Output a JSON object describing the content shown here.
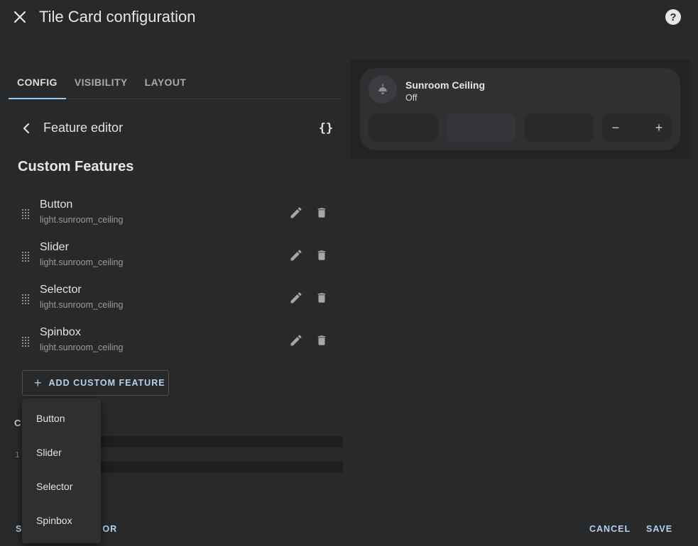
{
  "header": {
    "title": "Tile Card configuration",
    "close_icon": "close-icon",
    "help_icon": "help-circle-icon",
    "help_glyph": "?"
  },
  "tabs": [
    {
      "label": "CONFIG",
      "active": true
    },
    {
      "label": "VISIBILITY",
      "active": false
    },
    {
      "label": "LAYOUT",
      "active": false
    }
  ],
  "feature_editor": {
    "title": "Feature editor",
    "code_toggle_label": "{}"
  },
  "section_title": "Custom Features",
  "features": [
    {
      "name": "Button",
      "entity": "light.sunroom_ceiling"
    },
    {
      "name": "Slider",
      "entity": "light.sunroom_ceiling"
    },
    {
      "name": "Selector",
      "entity": "light.sunroom_ceiling"
    },
    {
      "name": "Spinbox",
      "entity": "light.sunroom_ceiling"
    }
  ],
  "add_button": {
    "plus": "+",
    "label": "ADD CUSTOM FEATURE"
  },
  "dropdown": {
    "items": [
      "Button",
      "Slider",
      "Selector",
      "Spinbox"
    ]
  },
  "code_section": {
    "label_partial": "C",
    "line_number": "1"
  },
  "footer": {
    "show_editor_partial": "S",
    "show_editor_partial_end": "OR",
    "cancel_label": "CANCEL",
    "save_label": "SAVE"
  },
  "preview": {
    "name": "Sunroom Ceiling",
    "state": "Off",
    "spin_minus": "−",
    "spin_plus": "+"
  },
  "colors": {
    "background": "#28292b",
    "accent": "#b6d2ea",
    "tab_indicator": "#9fc7e8"
  }
}
